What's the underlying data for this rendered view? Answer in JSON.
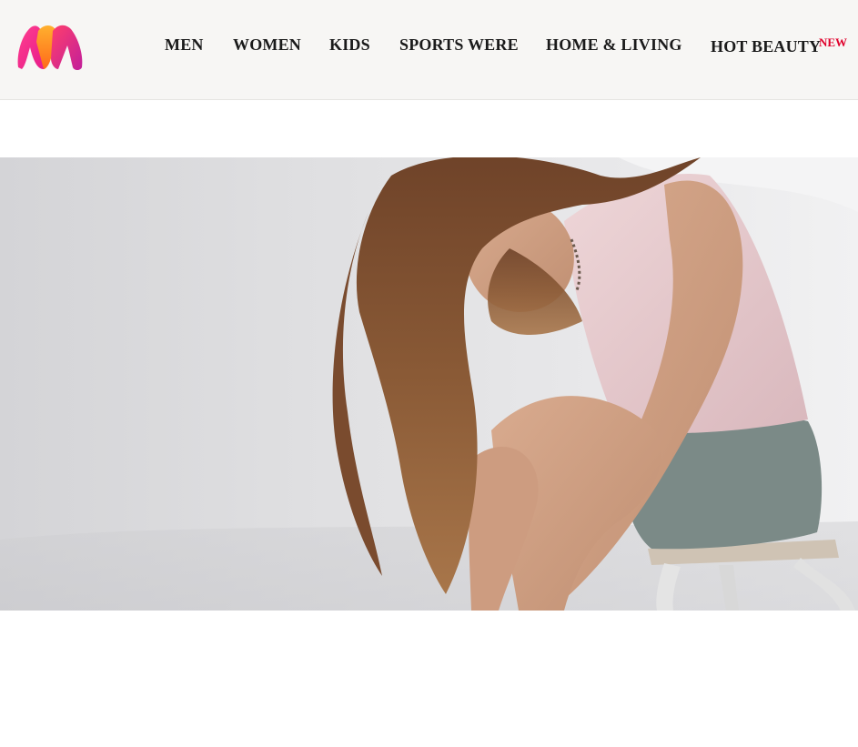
{
  "header": {
    "logo": {
      "icon": "myntra-m-logo-icon",
      "colors": [
        "#ff3f6c",
        "#f7a21b",
        "#c21f9a"
      ]
    },
    "nav": [
      {
        "label": "MEN"
      },
      {
        "label": "WOMEN"
      },
      {
        "label": "KIDS"
      },
      {
        "label": "SPORTS WERE"
      },
      {
        "label": "HOME & LIVING"
      },
      {
        "label": "HOT BEAUTY",
        "badge": "NEW"
      }
    ]
  },
  "hero": {
    "image": "model-sitting-on-stool-photo",
    "colors": {
      "background": "#d9d9db",
      "hair": "#8a5a36",
      "top": "#e6c9cd",
      "shorts": "#7b8a87"
    }
  }
}
